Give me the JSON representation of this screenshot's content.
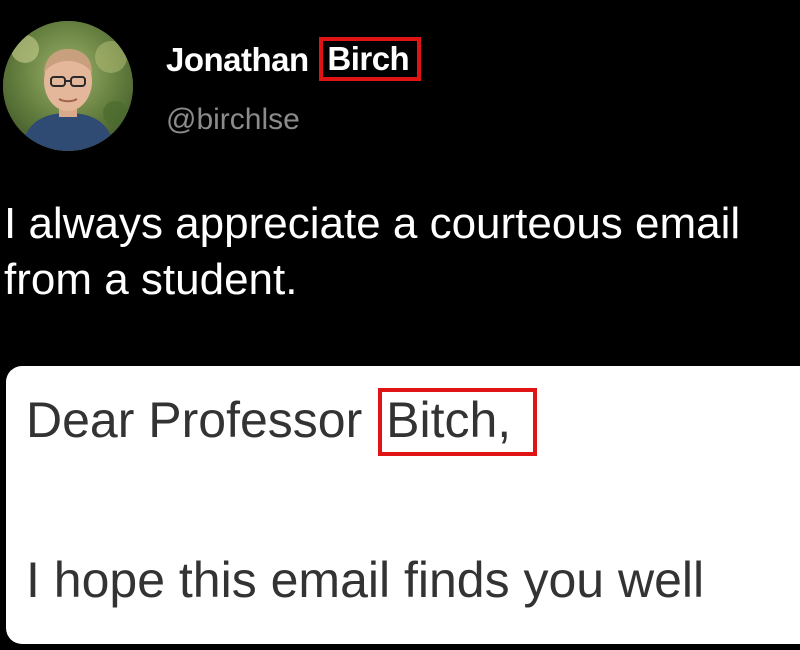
{
  "tweet": {
    "author": {
      "name_first": "Jonathan",
      "name_highlighted": "Birch",
      "handle": "@birchlse",
      "avatar_icon": "profile-photo"
    },
    "text": "I always appreciate a courteous email from a student."
  },
  "email": {
    "greeting_prefix": "Dear Professor",
    "greeting_highlighted": "Bitch,",
    "body": "I hope this email finds you well"
  },
  "colors": {
    "background": "#000000",
    "highlight_box": "#e01414",
    "handle_text": "#8b8b8b",
    "email_text": "#333333"
  }
}
